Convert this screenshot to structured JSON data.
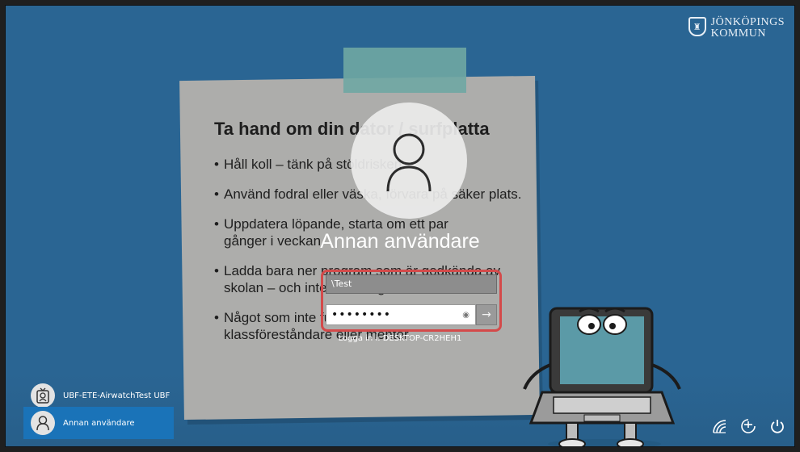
{
  "logo": {
    "line1": "JÖNKÖPINGS",
    "line2": "KOMMUN"
  },
  "note": {
    "title": "Ta hand om din dator / surfplatta",
    "bullets": [
      "Håll koll – tänk på stöldrisken.",
      "Använd fodral eller väska, förvara på säker plats.",
      "Uppdatera löpande, starta om ett par gånger i veckan.",
      "Ladda bara ner program som är godkända av skolan – och inte för många.",
      "Något som inte funkar? Kontakta din klassföreståndare eller mentor."
    ]
  },
  "login": {
    "username_title": "Annan användare",
    "user_field_value": "\\Test",
    "password_mask": "••••••••",
    "sign_in_to": "Logga in i: DESKTOP-CR2HEH1"
  },
  "users": [
    {
      "label": "UBF-ETE-AirwatchTest UBF",
      "icon": "account-badge-icon"
    },
    {
      "label": "Annan användare",
      "icon": "person-icon"
    }
  ],
  "system_icons": [
    "network-icon",
    "accessibility-icon",
    "power-icon"
  ],
  "colors": {
    "background": "#2a6593",
    "highlight_border": "#d44a4a",
    "selected_user": "#1a73b8"
  }
}
